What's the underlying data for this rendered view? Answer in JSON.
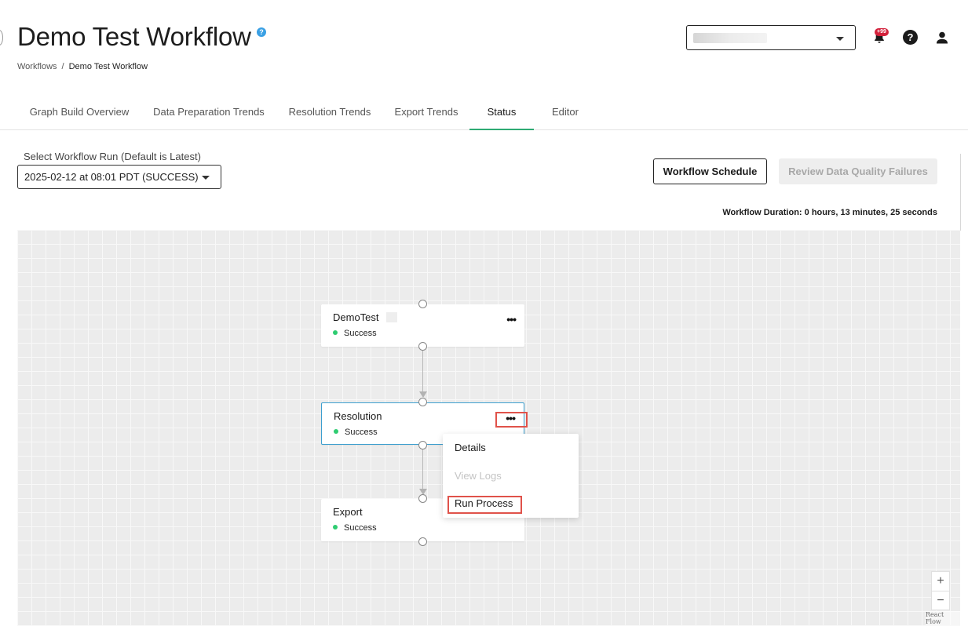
{
  "header": {
    "title": "Demo Test Workflow",
    "help_badge": "?",
    "notification_count": "+99",
    "help_icon": "?"
  },
  "breadcrumb": {
    "root": "Workflows",
    "separator": "/",
    "current": "Demo Test Workflow"
  },
  "tabs": [
    {
      "label": "Graph Build Overview"
    },
    {
      "label": "Data Preparation Trends"
    },
    {
      "label": "Resolution Trends"
    },
    {
      "label": "Export Trends"
    },
    {
      "label": "Status",
      "active": true
    },
    {
      "label": "Editor"
    }
  ],
  "run_selector": {
    "label": "Select Workflow Run (Default is Latest)",
    "value": "2025-02-12 at 08:01 PDT (SUCCESS)"
  },
  "actions": {
    "schedule_label": "Workflow Schedule",
    "review_label": "Review Data Quality Failures"
  },
  "duration": "Workflow Duration: 0 hours, 13 minutes, 25 seconds",
  "nodes": [
    {
      "title": "DemoTest",
      "status": "Success"
    },
    {
      "title": "Resolution",
      "status": "Success"
    },
    {
      "title": "Export",
      "status": "Success"
    }
  ],
  "node_menu_glyph": "•••",
  "context_menu": {
    "details": "Details",
    "view_logs": "View Logs",
    "run_process": "Run Process"
  },
  "zoom": {
    "in": "+",
    "out": "−"
  },
  "attribution": "React Flow",
  "colors": {
    "active_tab_underline": "#2eaa73",
    "success_dot": "#2ecc71",
    "selected_node_border": "#3d9fcf",
    "highlight": "#e0524a",
    "badge": "#d3213b"
  }
}
